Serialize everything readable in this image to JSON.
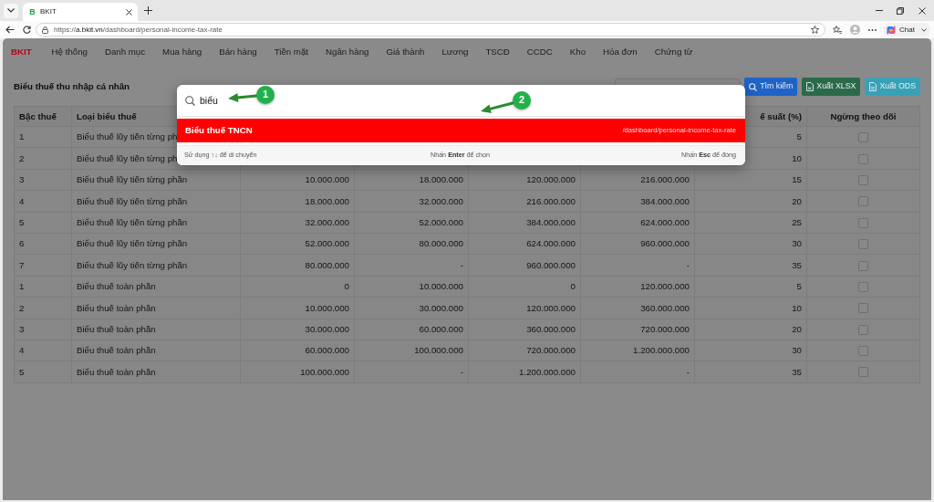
{
  "browser": {
    "tab": {
      "favicon": "B",
      "title": "BKIT",
      "selected": true
    },
    "address": {
      "scheme": "https://",
      "host": "a.bkit.vn",
      "path": "/dashboard/personal-income-tax-rate"
    },
    "chat_button": "Chat"
  },
  "app": {
    "brand": "BKIT",
    "menu": [
      "Hệ thống",
      "Danh mục",
      "Mua hàng",
      "Bán hàng",
      "Tiền mặt",
      "Ngân hàng",
      "Giá thành",
      "Lương",
      "TSCĐ",
      "CCDC",
      "Kho",
      "Hóa đơn",
      "Chứng từ"
    ]
  },
  "page": {
    "title": "Biểu thuế thu nhập cá nhân",
    "buttons": [
      {
        "kind": "search",
        "label": "Tìm kiếm"
      },
      {
        "kind": "xlsx",
        "label": "Xuất XLSX"
      },
      {
        "kind": "ods",
        "label": "Xuất ODS"
      }
    ]
  },
  "table": {
    "columns": [
      "Bậc thuế",
      "Loại biểu thuế",
      null,
      null,
      null,
      null,
      "ế suất (%)",
      "Ngừng theo dõi"
    ],
    "rows": [
      {
        "cells": [
          "1",
          "Biểu thuế lũy tiến từng ph",
          null,
          null,
          null,
          null,
          "5"
        ],
        "checked": false
      },
      {
        "cells": [
          "2",
          "Biểu thuế lũy tiến từng ph",
          null,
          null,
          null,
          null,
          "10"
        ],
        "checked": false
      },
      {
        "cells": [
          "3",
          "Biểu thuế lũy tiến từng phần",
          "10.000.000",
          "18.000.000",
          "120.000.000",
          "216.000.000",
          "15"
        ],
        "checked": false
      },
      {
        "cells": [
          "4",
          "Biểu thuế lũy tiến từng phần",
          "18.000.000",
          "32.000.000",
          "216.000.000",
          "384.000.000",
          "20"
        ],
        "checked": false
      },
      {
        "cells": [
          "5",
          "Biểu thuế lũy tiến từng phần",
          "32.000.000",
          "52.000.000",
          "384.000.000",
          "624.000.000",
          "25"
        ],
        "checked": false
      },
      {
        "cells": [
          "6",
          "Biểu thuế lũy tiến từng phần",
          "52.000.000",
          "80.000.000",
          "624.000.000",
          "960.000.000",
          "30"
        ],
        "checked": false
      },
      {
        "cells": [
          "7",
          "Biểu thuế lũy tiến từng phần",
          "80.000.000",
          "-",
          "960.000.000",
          "-",
          "35"
        ],
        "checked": false
      },
      {
        "cells": [
          "1",
          "Biểu thuế toàn phần",
          "0",
          "10.000.000",
          "0",
          "120.000.000",
          "5"
        ],
        "checked": false
      },
      {
        "cells": [
          "2",
          "Biểu thuế toàn phần",
          "10.000.000",
          "30.000.000",
          "120.000.000",
          "360.000.000",
          "10"
        ],
        "checked": false
      },
      {
        "cells": [
          "3",
          "Biểu thuế toàn phần",
          "30.000.000",
          "60.000.000",
          "360.000.000",
          "720.000.000",
          "20"
        ],
        "checked": false
      },
      {
        "cells": [
          "4",
          "Biểu thuế toàn phần",
          "60.000.000",
          "100.000.000",
          "720.000.000",
          "1.200.000.000",
          "30"
        ],
        "checked": false
      },
      {
        "cells": [
          "5",
          "Biểu thuế toàn phần",
          "100.000.000",
          "-",
          "1.200.000.000",
          "-",
          "35"
        ],
        "checked": false
      }
    ]
  },
  "command_palette": {
    "query": "biểu",
    "results": [
      {
        "title": "Biểu thuế TNCN",
        "path": "/dashboard/personal-income-tax-rate",
        "selected": true
      }
    ],
    "hints": [
      "Sử dụng ↑↓ để di chuyển",
      "Nhấn **Enter** để chọn",
      "Nhấn **Esc** để đóng"
    ]
  },
  "annotations": [
    {
      "number": "1"
    },
    {
      "number": "2"
    }
  ]
}
